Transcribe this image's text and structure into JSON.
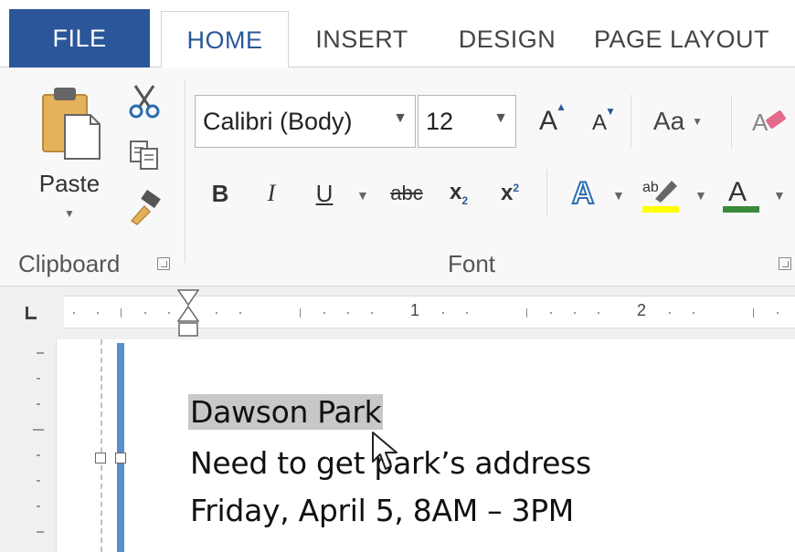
{
  "tabs": {
    "file": "FILE",
    "home": "HOME",
    "insert": "INSERT",
    "design": "DESIGN",
    "page_layout": "PAGE LAYOUT"
  },
  "clipboard": {
    "paste_label": "Paste",
    "group_label": "Clipboard"
  },
  "font": {
    "font_name": "Calibri (Body)",
    "font_size": "12",
    "change_case_label": "Aa",
    "group_label": "Font",
    "bold_glyph": "B",
    "italic_glyph": "I",
    "underline_glyph": "U",
    "strike_glyph": "abc"
  },
  "ruler": {
    "numbers": [
      "1",
      "2"
    ]
  },
  "document": {
    "lines": [
      "Dawson Park",
      "Need to get park’s address",
      "Friday, April 5, 8AM – 3PM"
    ]
  },
  "colors": {
    "accent": "#2b579a",
    "selection": "#c8c8c8",
    "highlight": "#ffff00",
    "font_color": "#3a8a3a",
    "margin_bar": "#5b8fc7"
  }
}
